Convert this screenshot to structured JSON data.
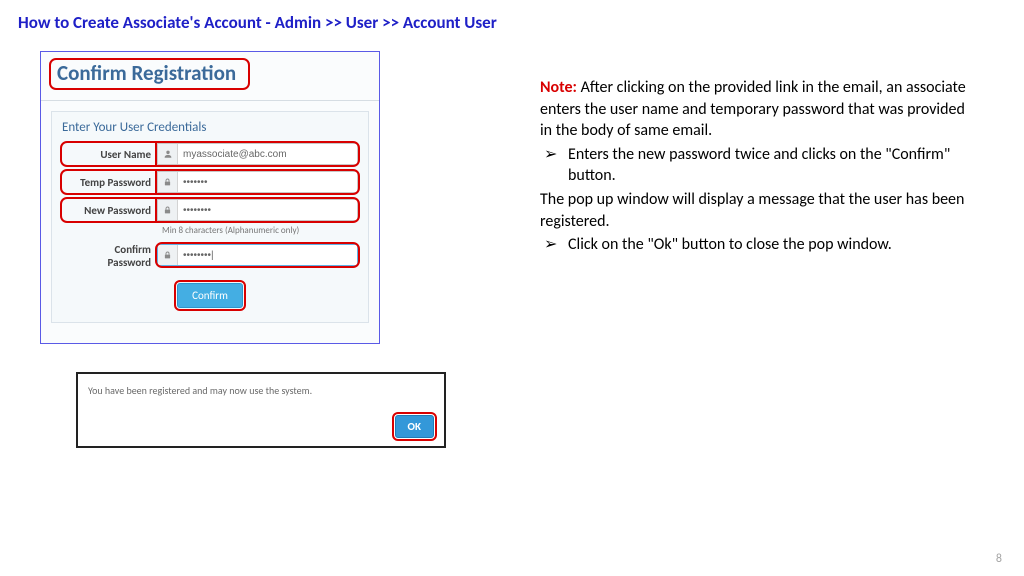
{
  "title": "How to Create Associate's Account  - Admin >> User >> Account User",
  "reg": {
    "heading": "Confirm Registration",
    "subheading": "Enter Your User Credentials",
    "user_label": "User Name",
    "user_value": "myassociate@abc.com",
    "temp_label": "Temp Password",
    "temp_value": "•••••••",
    "new_label": "New Password",
    "new_value": "••••••••",
    "hint": "Min 8 characters (Alphanumeric only)",
    "confirm_label1": "Confirm",
    "confirm_label2": "Password",
    "confirm_value": "••••••••|",
    "confirm_btn": "Confirm"
  },
  "msg": {
    "text": "You have been registered and may now use the system.",
    "ok": "OK"
  },
  "note": {
    "label": "Note:",
    "p1": " After clicking on the provided link in the email, an associate enters the user name and temporary password that was provided in the body of same email.",
    "b1": "Enters the new password twice and clicks on the \"Confirm\" button.",
    "p2": "The pop up window will display a message that the user has been registered.",
    "b2": "Click on the \"Ok\" button to close the pop window."
  },
  "page": "8"
}
